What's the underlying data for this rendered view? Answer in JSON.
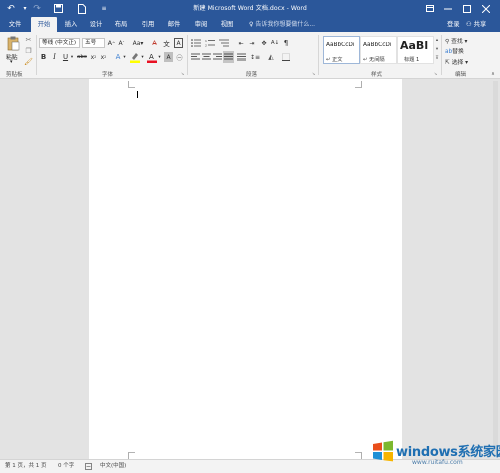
{
  "window": {
    "title": "新建 Microsoft Word 文档.docx - Word",
    "quick_access": [
      "undo-icon",
      "redo-icon",
      "save-icon",
      "new-document-icon",
      "customize-icon"
    ],
    "controls": [
      "ribbon-display-icon",
      "minimize-icon",
      "maximize-icon",
      "close-icon"
    ]
  },
  "tabs": [
    {
      "label": "文件",
      "active": false
    },
    {
      "label": "开始",
      "active": true
    },
    {
      "label": "插入",
      "active": false
    },
    {
      "label": "设计",
      "active": false
    },
    {
      "label": "布局",
      "active": false
    },
    {
      "label": "引用",
      "active": false
    },
    {
      "label": "邮件",
      "active": false
    },
    {
      "label": "审阅",
      "active": false
    },
    {
      "label": "视图",
      "active": false
    }
  ],
  "tell_me": "告诉我你想要做什么...",
  "account": {
    "login": "登录",
    "share": "共享"
  },
  "ribbon": {
    "clipboard": {
      "label": "剪贴板",
      "paste": "粘贴"
    },
    "font": {
      "label": "字体",
      "font_name": "等线 (中文正)",
      "font_size": "五号"
    },
    "paragraph": {
      "label": "段落"
    },
    "styles": {
      "label": "样式",
      "items": [
        {
          "sample": "AaBbCcDı",
          "name": "正文",
          "selected": true
        },
        {
          "sample": "AaBbCcDı",
          "name": "无间隔",
          "selected": false
        },
        {
          "sample": "AaBl",
          "name": "标题 1",
          "selected": false
        }
      ]
    },
    "editing": {
      "label": "编辑",
      "find": "查找",
      "replace": "替换",
      "select": "选择"
    }
  },
  "status_bar": {
    "page": "第 1 页，共 1 页",
    "words": "0 个字",
    "language": "中文(中国)"
  },
  "watermark": {
    "title": "windows系统家园",
    "url": "www.ruitafu.com"
  },
  "colors": {
    "accent": "#2b579a",
    "ribbon": "#f3f3f3",
    "workspace": "#e3e3e3",
    "highlight": "#ffff00",
    "font_color": "#e81123"
  }
}
